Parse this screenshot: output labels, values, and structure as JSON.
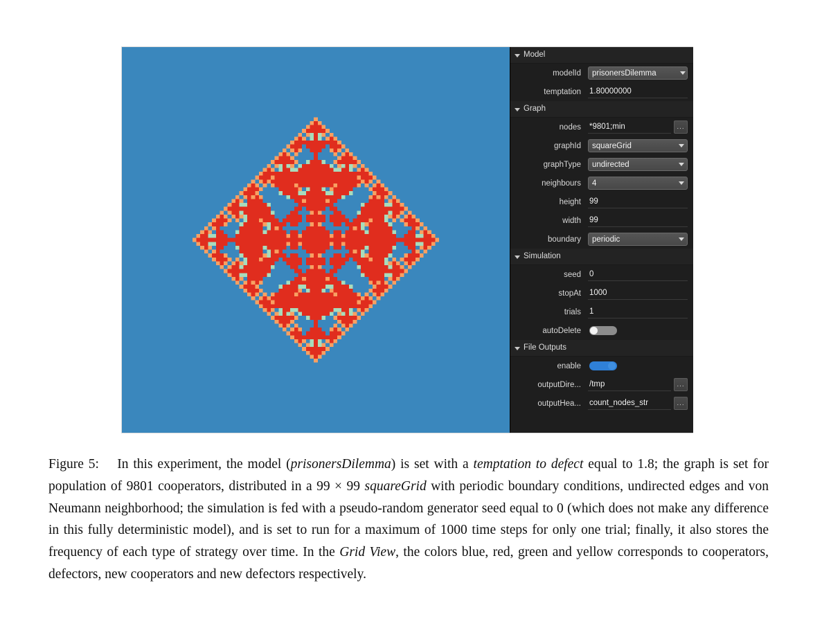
{
  "figure": {
    "grid_view": {
      "name": "Grid View",
      "rows": 99,
      "cols": 99,
      "legend": {
        "blue": "cooperators",
        "red": "defectors",
        "green": "new cooperators",
        "yellow": "new defectors"
      },
      "colors": {
        "cooperator": "#3a87bd",
        "defector": "#e02d1e",
        "new_cooperator": "#a8dcbc",
        "new_defector": "#f8a062"
      }
    },
    "panel": {
      "sections": [
        {
          "id": "model",
          "title": "Model",
          "expanded": true,
          "rows": [
            {
              "label": "modelId",
              "value": "prisonersDilemma",
              "type": "combo"
            },
            {
              "label": "temptation",
              "value": "1.80000000",
              "type": "text"
            }
          ]
        },
        {
          "id": "graph",
          "title": "Graph",
          "expanded": true,
          "rows": [
            {
              "label": "nodes",
              "value": "*9801;min",
              "type": "text-browse",
              "browse_label": "..."
            },
            {
              "label": "graphId",
              "value": "squareGrid",
              "type": "combo"
            },
            {
              "label": "graphType",
              "value": "undirected",
              "type": "combo"
            },
            {
              "label": "neighbours",
              "value": "4",
              "type": "combo"
            },
            {
              "label": "height",
              "value": "99",
              "type": "text"
            },
            {
              "label": "width",
              "value": "99",
              "type": "text"
            },
            {
              "label": "boundary",
              "value": "periodic",
              "type": "combo"
            }
          ]
        },
        {
          "id": "simulation",
          "title": "Simulation",
          "expanded": true,
          "rows": [
            {
              "label": "seed",
              "value": "0",
              "type": "text"
            },
            {
              "label": "stopAt",
              "value": "1000",
              "type": "text"
            },
            {
              "label": "trials",
              "value": "1",
              "type": "text"
            },
            {
              "label": "autoDelete",
              "value": "",
              "type": "switch",
              "state": "off"
            }
          ]
        },
        {
          "id": "file-outputs",
          "title": "File Outputs",
          "expanded": true,
          "rows": [
            {
              "label": "enable",
              "value": "",
              "type": "switch",
              "state": "on"
            },
            {
              "label": "outputDire...",
              "value": "/tmp",
              "type": "text-browse",
              "browse_label": "..."
            },
            {
              "label": "outputHea...",
              "value": "count_nodes_str",
              "type": "text-browse",
              "browse_label": "..."
            }
          ]
        }
      ]
    }
  },
  "caption": {
    "label": "Figure 5:",
    "parts": [
      {
        "t": "In this experiment, the model (",
        "i": false
      },
      {
        "t": "prisonersDilemma",
        "i": true
      },
      {
        "t": ") is set with a ",
        "i": false
      },
      {
        "t": "temptation to defect",
        "i": true
      },
      {
        "t": " equal to 1.8; the graph is set for population of 9801 cooperators, distributed in a 99 × 99 ",
        "i": false
      },
      {
        "t": "squareGrid",
        "i": true
      },
      {
        "t": " with periodic boundary conditions, undirected edges and von Neumann neighborhood; the simulation is fed with a pseudo-random generator seed equal to 0 (which does not make any difference in this fully deterministic model), and is set to run for a maximum of 1000 time steps for only one trial; finally, it also stores the frequency of each type of strategy over time. In the ",
        "i": false
      },
      {
        "t": "Grid View",
        "i": true
      },
      {
        "t": ", the colors blue, red, green and yellow corresponds to cooperators, defectors, new cooperators and new defectors respectively.",
        "i": false
      }
    ]
  }
}
